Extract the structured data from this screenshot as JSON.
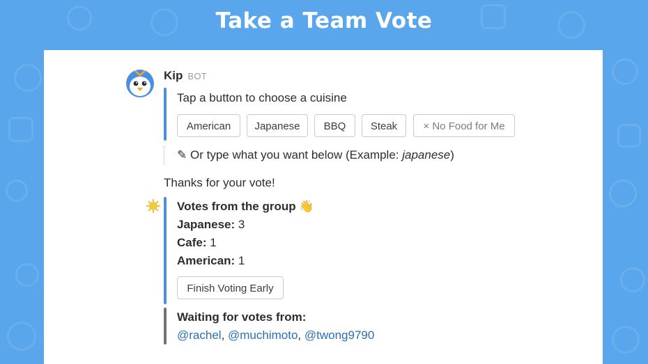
{
  "banner": {
    "title": "Take a Team Vote"
  },
  "message": {
    "sender": "Kip",
    "sender_tag": "BOT",
    "prompt": "Tap a button to choose a cuisine",
    "cuisine_buttons": [
      "American",
      "Japanese",
      "BBQ",
      "Steak",
      "× No Food for Me"
    ],
    "hint_icon": "pencil-icon",
    "hint_text": "Or type what you want below (Example: ",
    "hint_example": "japanese",
    "hint_close": ")"
  },
  "thanks": "Thanks for your vote!",
  "results": {
    "icon": "sun-icon",
    "title": "Votes from the group",
    "title_emoji": "👋",
    "rows": [
      {
        "label": "Japanese:",
        "count": "3"
      },
      {
        "label": "Cafe:",
        "count": "1"
      },
      {
        "label": "American:",
        "count": "1"
      }
    ],
    "finish_label": "Finish Voting Early"
  },
  "waiting": {
    "title": "Waiting for votes from:",
    "users": [
      "@rachel",
      "@muchimoto",
      "@twong9790"
    ],
    "separator": ", "
  },
  "colors": {
    "background": "#59a6ec",
    "attachment_bar": "#4a90e2",
    "waiting_bar": "#6f7870",
    "mention": "#2a6fb5"
  }
}
